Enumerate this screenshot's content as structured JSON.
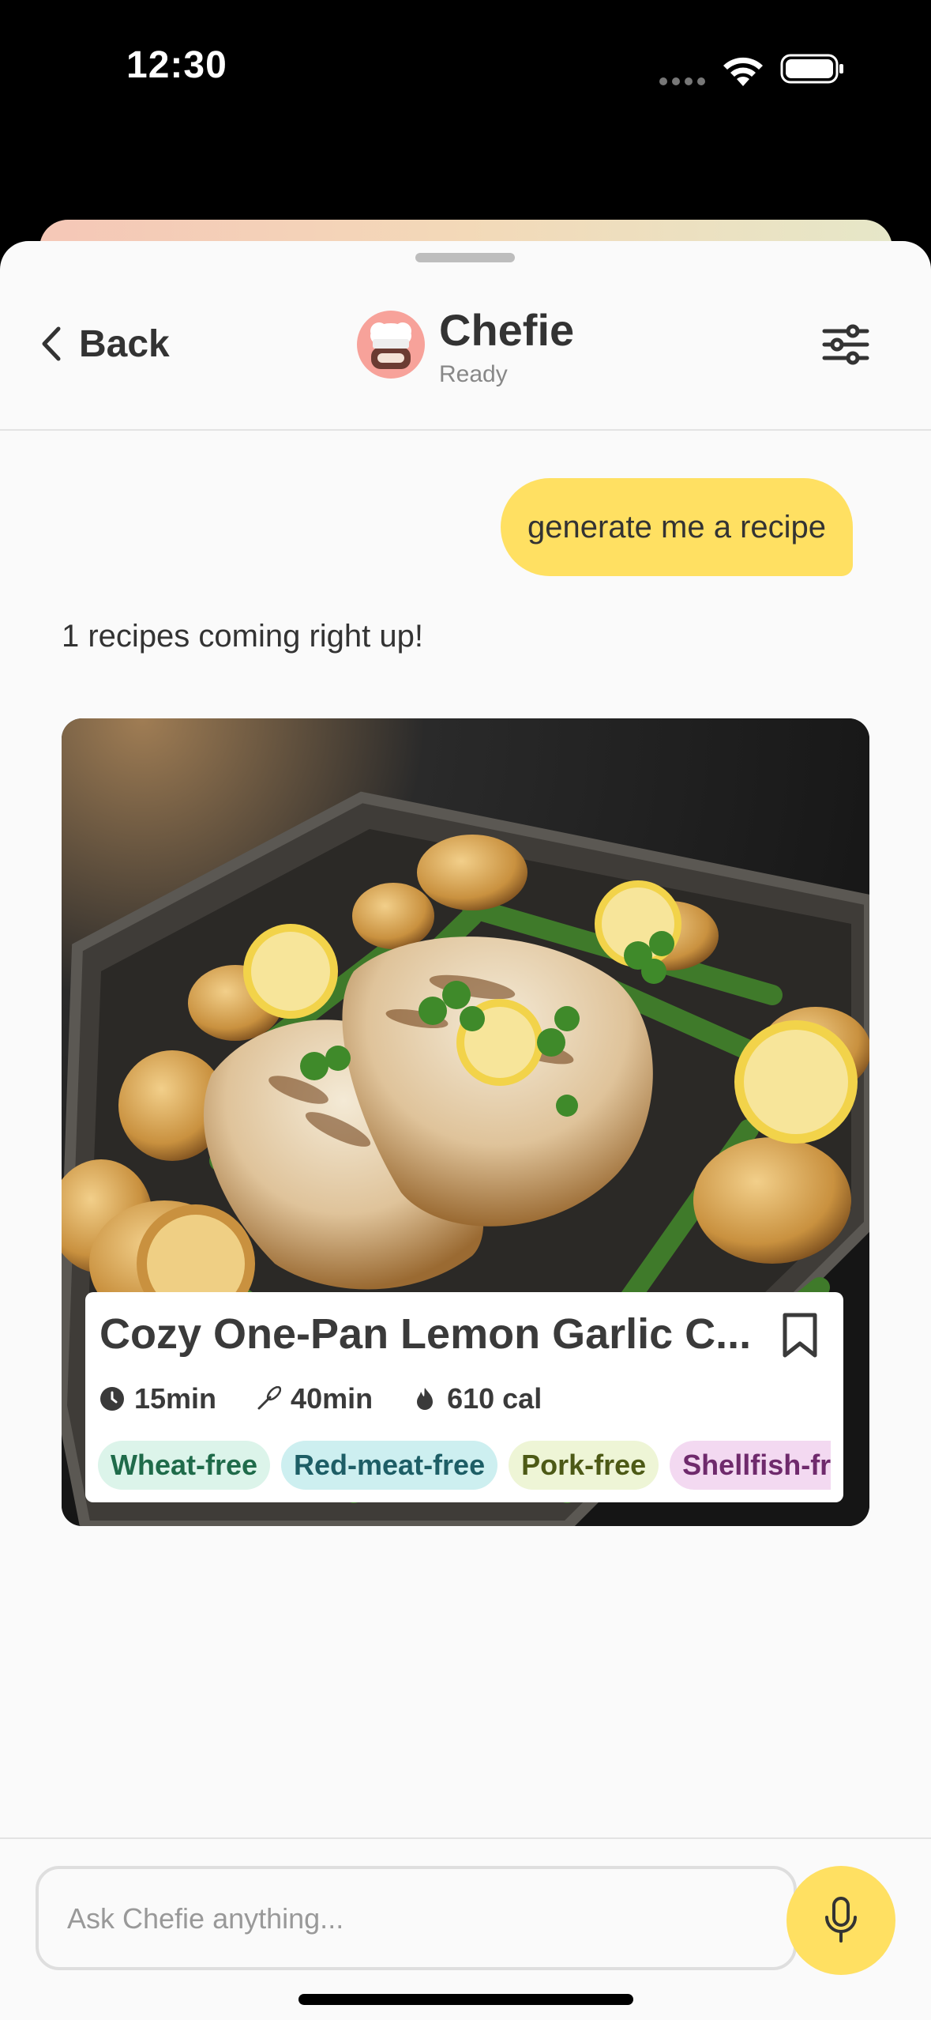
{
  "status_bar": {
    "time": "12:30"
  },
  "header": {
    "back_label": "Back",
    "bot_name": "Chefie",
    "bot_status": "Ready"
  },
  "chat": {
    "user_message": "generate me a recipe",
    "bot_message": "1 recipes coming right up!"
  },
  "recipe": {
    "title": "Cozy One-Pan Lemon Garlic C...",
    "prep_time": "15min",
    "cook_time": "40min",
    "calories": "610 cal",
    "tags": [
      {
        "label": "Wheat-free",
        "bg": "#dcf4ea",
        "color": "#1f6b4a"
      },
      {
        "label": "Red-meat-free",
        "bg": "#cdeff0",
        "color": "#1d5e66"
      },
      {
        "label": "Pork-free",
        "bg": "#eef5d6",
        "color": "#4d5a16"
      },
      {
        "label": "Shellfish-free",
        "bg": "#f3d9f1",
        "color": "#6f2a6c"
      }
    ]
  },
  "input": {
    "placeholder": "Ask Chefie anything..."
  },
  "colors": {
    "accent": "#ffe062",
    "sheet_bg": "#fafafa",
    "text": "#333333"
  }
}
